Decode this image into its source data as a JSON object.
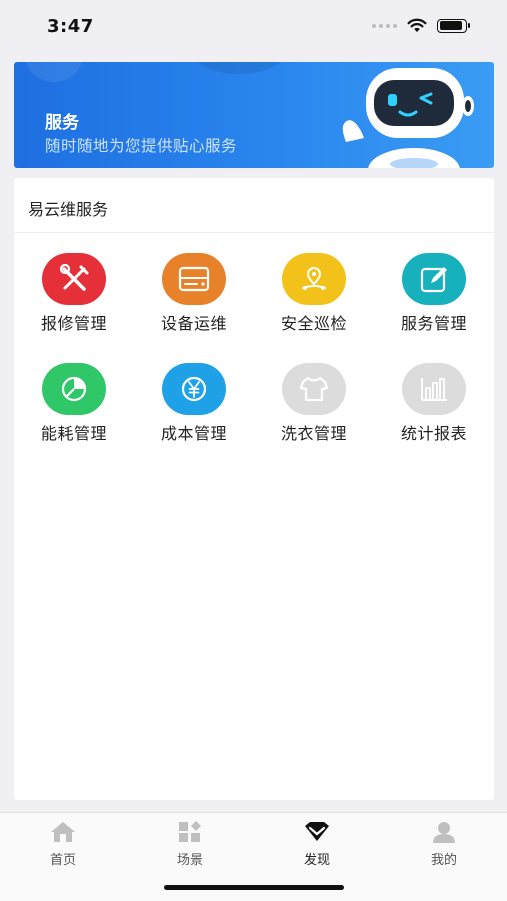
{
  "status": {
    "time": "3:47"
  },
  "banner": {
    "title": "服务",
    "subtitle": "随时随地为您提供贴心服务"
  },
  "section": {
    "title": "易云维服务"
  },
  "services": [
    {
      "label": "报修管理",
      "icon": "repair-tools-icon",
      "color": "#e5303a"
    },
    {
      "label": "设备运维",
      "icon": "device-icon",
      "color": "#e8822a"
    },
    {
      "label": "安全巡检",
      "icon": "patrol-location-icon",
      "color": "#f3c21a"
    },
    {
      "label": "服务管理",
      "icon": "edit-note-icon",
      "color": "#17b1be"
    },
    {
      "label": "能耗管理",
      "icon": "pie-chart-icon",
      "color": "#2fc768"
    },
    {
      "label": "成本管理",
      "icon": "yen-coin-icon",
      "color": "#1ea1e6"
    },
    {
      "label": "洗衣管理",
      "icon": "shirt-icon",
      "color": "#dcdcdc"
    },
    {
      "label": "统计报表",
      "icon": "bar-chart-icon",
      "color": "#dcdcdc"
    }
  ],
  "tabs": [
    {
      "label": "首页",
      "icon": "home-icon"
    },
    {
      "label": "场景",
      "icon": "scene-grid-icon"
    },
    {
      "label": "发现",
      "icon": "discover-diamond-icon",
      "active": true
    },
    {
      "label": "我的",
      "icon": "user-icon"
    }
  ]
}
